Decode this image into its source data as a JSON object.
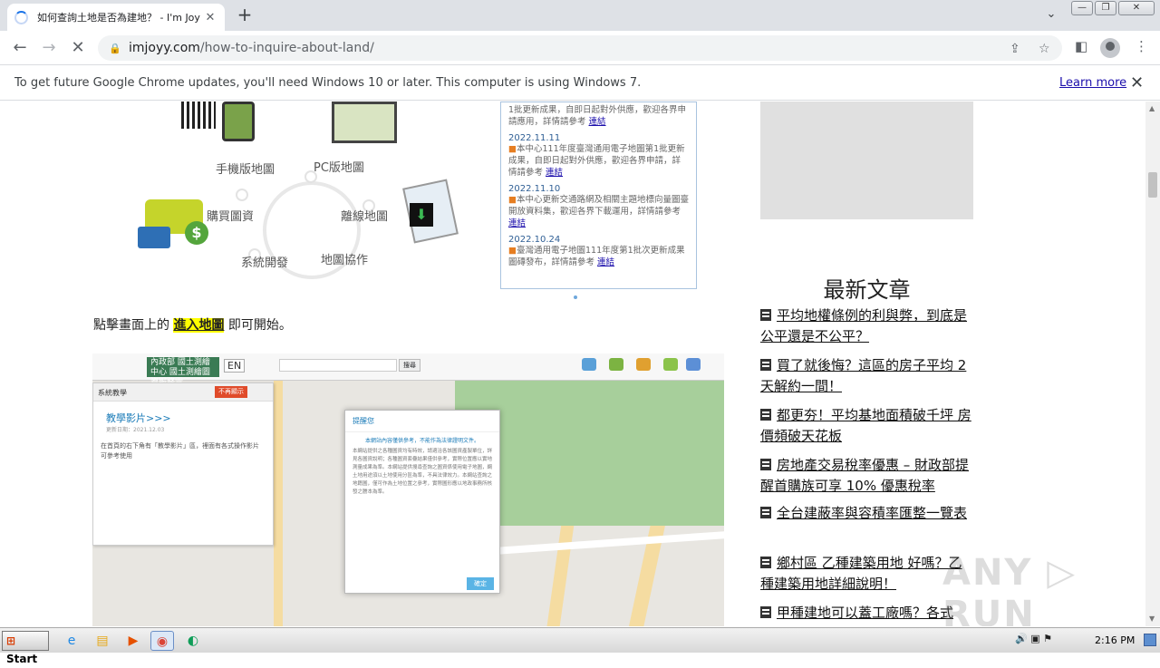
{
  "browser": {
    "tab_title": "如何查詢土地是否為建地？ - I'm Joy",
    "tab_close": "✕",
    "new_tab": "+",
    "tab_menu": "⌄",
    "url_host": "imjoyy.com",
    "url_path": "/how-to-inquire-about-land/",
    "window_buttons": [
      "—",
      "❐",
      "✕"
    ]
  },
  "infobar": {
    "message": "To get future Google Chrome updates, you'll need Windows 10 or later. This computer is using Windows 7.",
    "learn_more": "Learn more",
    "close": "✕"
  },
  "hero": {
    "labels": [
      "手機版地圖",
      "PC版地圖",
      "購買圖資",
      "離線地圖",
      "系統開發",
      "地圖協作"
    ]
  },
  "news": {
    "items": [
      {
        "date": "",
        "text": "1批更新成果，自即日起對外供應，歡迎各界申請應用，詳情請參考",
        "link": "連結"
      },
      {
        "date": "2022.11.11",
        "text": "本中心111年度臺灣通用電子地圖第1批更新成果，自即日起對外供應，歡迎各界申請，詳情請參考",
        "link": "連結"
      },
      {
        "date": "2022.11.10",
        "text": "本中心更新交通路網及相關主題地標向量圖臺開放資料集，歡迎各界下載運用，詳情請參考",
        "link": "連結"
      },
      {
        "date": "2022.10.24",
        "text": "臺灣通用電子地圖111年度第1批次更新成果圖磚發布，詳情請參考",
        "link": "連結"
      }
    ]
  },
  "paragraph": {
    "before": "點擊畫面上的 ",
    "highlight": "進入地圖",
    "after": " 即可開始。"
  },
  "map_shot": {
    "logo": "內政部 國土測繪中心 國土測繪圖資服務雲",
    "en": "EN",
    "search_btn": "搜尋",
    "panel_header": "系統教學",
    "panel_button": "不再顯示",
    "panel_title": "教學影片>>>",
    "panel_date": "更新日期：2021.12.03",
    "panel_text": "在首頁的右下角有「教學影片」區，裡面有各式操作影片可參考使用",
    "dialog_title": "提醒您",
    "dialog_subtitle": "本網站內容僅供參考，不能作為法律證明文件。",
    "dialog_body": "本網站提供之各種圖資均有時效，請適洽各該圖資產製單位，詳見各圖資說明；各種圖資套疊結果僅供參考，實際位置應以實地測量成果為準。本網站提供搜尋查詢之圖資係使用電子地圖，網土地用途須以土地使用分區為準，不具法律效力。本網站查詢之地籍圖，僅可作為土地位置之參考，實際圖形應以地政事務所核發之謄本為準。",
    "dialog_ok": "確定"
  },
  "sidebar": {
    "title": "最新文章",
    "articles": [
      "平均地權條例的利與弊，到底是公平還是不公平？",
      "買了就後悔？這區的房子平均 2 天解約一間！",
      "都更夯！平均基地面積破千坪 房價頻破天花板",
      "房地產交易稅率優惠 – 財政部提醒首購族可享 10% 優惠稅率",
      "全台建蔽率與容積率匯整一覽表",
      "鄉村區 乙種建築用地 好嗎？乙種建築用地詳細說明！",
      "甲種建地可以蓋工廠嗎？各式"
    ]
  },
  "watermark": "ANY ▷ RUN",
  "taskbar": {
    "start": "Start",
    "time": "2:16 PM"
  },
  "colors": {
    "accent": "#1a73e8",
    "highlight": "#ffff00",
    "news_border": "#a9c3df"
  }
}
